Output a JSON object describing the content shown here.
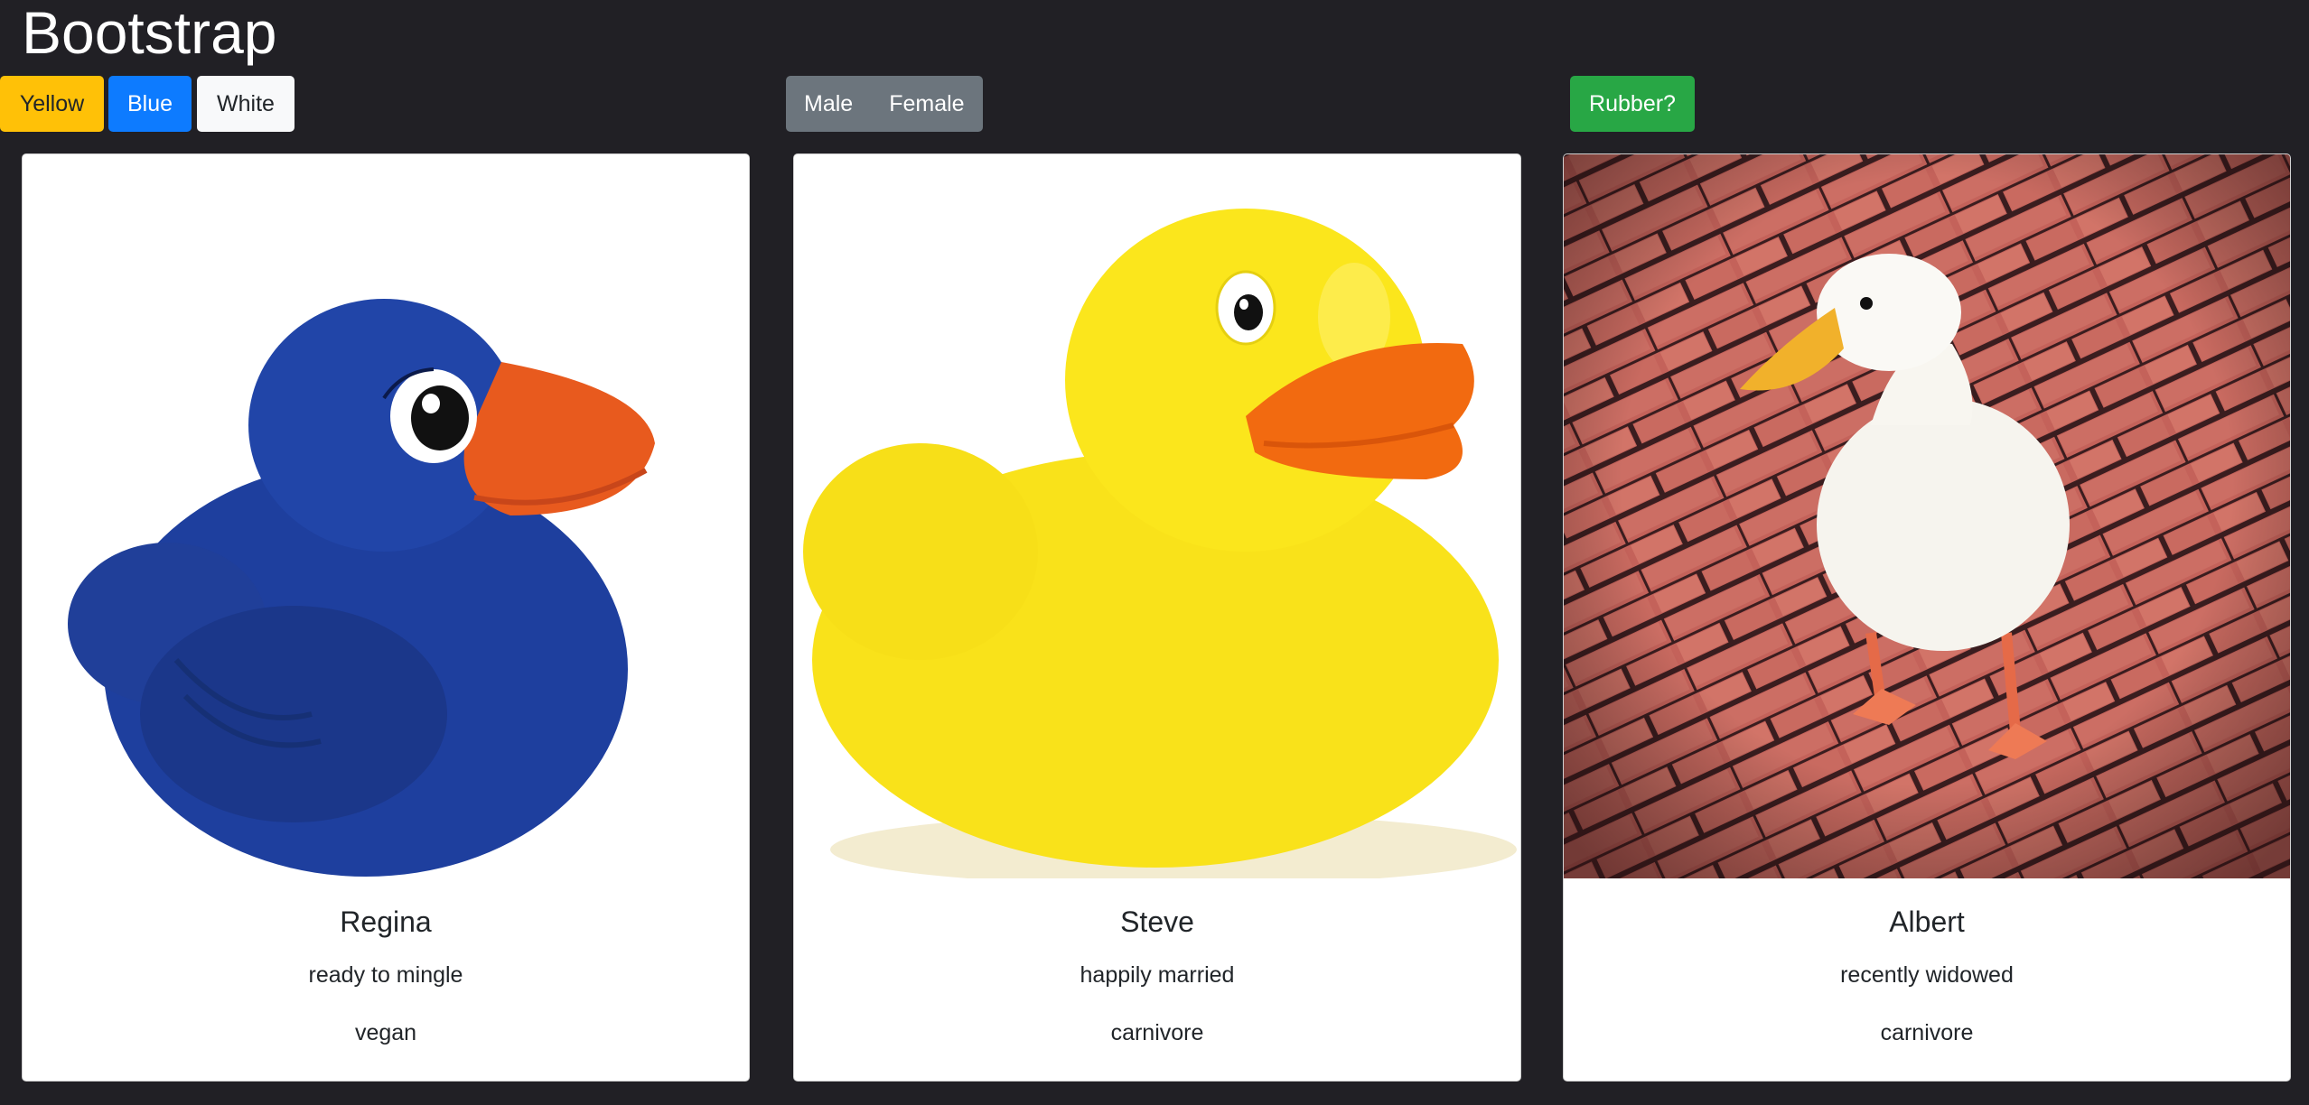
{
  "header": {
    "title": "Bootstrap"
  },
  "filters": {
    "colors": {
      "yellow_label": "Yellow",
      "blue_label": "Blue",
      "white_label": "White"
    },
    "gender": {
      "male_label": "Male",
      "female_label": "Female"
    },
    "rubber_label": "Rubber?"
  },
  "theme": {
    "background": "#212025",
    "yellow": "#ffc107",
    "blue": "#0d7bff",
    "white": "#f8f9fa",
    "secondary": "#6c757d",
    "success": "#28a745"
  },
  "cards": [
    {
      "name": "Regina",
      "status": "ready to mingle",
      "diet": "vegan",
      "image": "blue-rubber-duck-image"
    },
    {
      "name": "Steve",
      "status": "happily married",
      "diet": "carnivore",
      "image": "yellow-rubber-duck-image"
    },
    {
      "name": "Albert",
      "status": "recently widowed",
      "diet": "carnivore",
      "image": "white-duck-on-bricks-image"
    }
  ]
}
